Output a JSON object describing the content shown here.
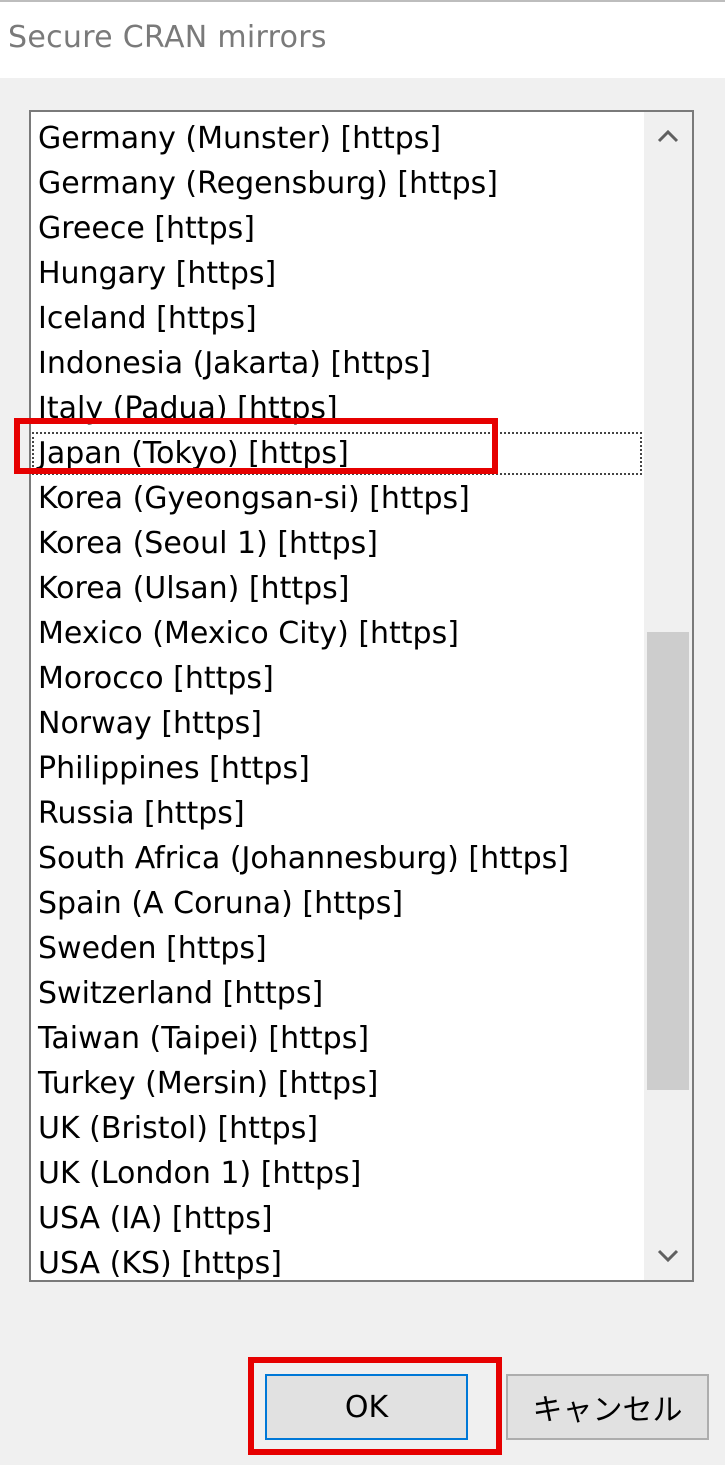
{
  "window": {
    "title": "Secure CRAN mirrors"
  },
  "mirror_list": {
    "clipped_top_item": "Italy (Padua) [https]",
    "items": [
      "Germany (Munster) [https]",
      "Germany (Regensburg) [https]",
      "Greece [https]",
      "Hungary [https]",
      "Iceland [https]",
      "Indonesia (Jakarta) [https]",
      "Italy (Padua) [https]",
      "Japan (Tokyo) [https]",
      "Korea (Gyeongsan-si) [https]",
      "Korea (Seoul 1) [https]",
      "Korea (Ulsan) [https]",
      "Mexico (Mexico City) [https]",
      "Morocco [https]",
      "Norway [https]",
      "Philippines [https]",
      "Russia [https]",
      "South Africa (Johannesburg) [https]",
      "Spain (A Coruna) [https]",
      "Sweden [https]",
      "Switzerland [https]",
      "Taiwan (Taipei) [https]",
      "Turkey (Mersin) [https]",
      "UK (Bristol) [https]",
      "UK (London 1) [https]",
      "USA (IA) [https]",
      "USA (KS) [https]"
    ],
    "selected": "Japan (Tokyo) [https]"
  },
  "scrollbar": {
    "up_icon": "chevron-up-icon",
    "down_icon": "chevron-down-icon",
    "thumb_position_fraction": 0.45,
    "thumb_size_fraction": 0.39
  },
  "buttons": {
    "ok_label": "OK",
    "cancel_label": "キャンセル"
  },
  "colors": {
    "highlight": "#e60000",
    "focus_border": "#0078d7"
  }
}
